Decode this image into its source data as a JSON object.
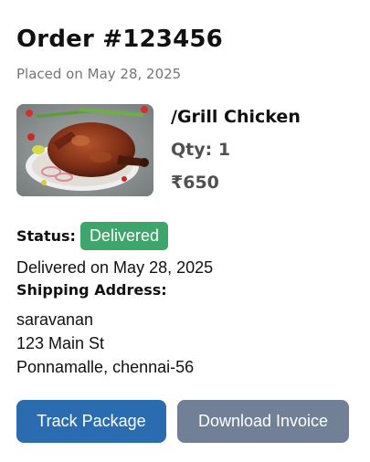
{
  "order": {
    "title": "Order #123456",
    "placed_on": "Placed on May 28, 2025"
  },
  "product": {
    "image_icon": "grilled-chicken-photo",
    "name": "/Grill Chicken",
    "qty": "Qty: 1",
    "price": "₹650"
  },
  "status": {
    "label": "Status:",
    "value": "Delivered",
    "color": "#3ea66a",
    "delivered_on": "Delivered on May 28, 2025"
  },
  "shipping": {
    "label": "Shipping Address:",
    "lines": [
      "saravanan",
      "123 Main St",
      "Ponnamalle, chennai-56"
    ]
  },
  "actions": {
    "track_label": "Track Package",
    "track_color": "#2b6cb0",
    "invoice_label": "Download Invoice",
    "invoice_color": "#718096"
  }
}
